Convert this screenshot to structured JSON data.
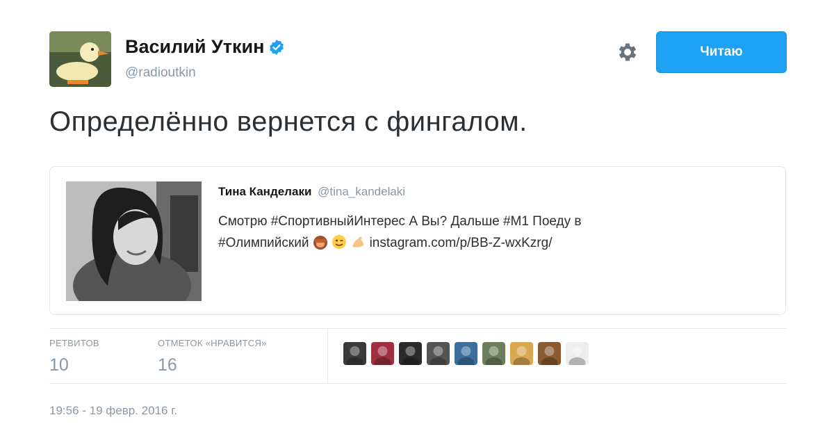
{
  "author": {
    "name": "Василий Уткин",
    "handle": "@radioutkin",
    "verified": true
  },
  "follow_button": {
    "label": "Читаю"
  },
  "tweet": {
    "text": "Определённо вернется с фингалом."
  },
  "quoted_tweet": {
    "name": "Тина Канделаки",
    "handle": "@tina_kandelaki",
    "text_line1": "Смотрю #СпортивныйИнтерес А Вы? Дальше #М1 Поеду в",
    "text_line2_start": "#Олимпийский",
    "link": "instagram.com/p/BB-Z-wxKzrg/",
    "emojis": [
      "see-no-evil-monkey-icon",
      "winking-face-icon",
      "flexed-biceps-icon"
    ]
  },
  "stats": {
    "retweets_label": "РЕТВИТОВ",
    "retweets_value": "10",
    "likes_label": "ОТМЕТОК «НРАВИТСЯ»",
    "likes_value": "16"
  },
  "likers": [
    {
      "color": "#3a3a3a"
    },
    {
      "color": "#a03040"
    },
    {
      "color": "#2a2a2a"
    },
    {
      "color": "#555555"
    },
    {
      "color": "#3d6f9c"
    },
    {
      "color": "#6e7d5b"
    },
    {
      "color": "#d9a850"
    },
    {
      "color": "#8a5a30"
    },
    {
      "color": "#eeeeee"
    }
  ],
  "timestamp": "19:56 - 19 февр. 2016 г.",
  "colors": {
    "accent": "#1da1f2",
    "muted": "#8899a6",
    "text": "#292f33"
  }
}
